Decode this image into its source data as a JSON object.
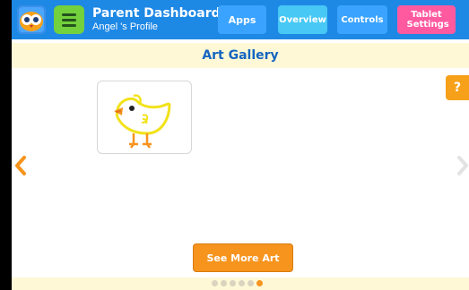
{
  "header": {
    "title": "Parent Dashboard",
    "subtitle": "Angel 's Profile",
    "tabs": [
      {
        "label": "Apps"
      },
      {
        "label": "Overview"
      },
      {
        "label": "Controls"
      },
      {
        "label": "Tablet Settings"
      }
    ],
    "active_tab": "Overview",
    "icons": {
      "logo": "owl-face-icon",
      "menu": "hamburger-menu-icon"
    }
  },
  "section": {
    "title": "Art Gallery"
  },
  "help": {
    "label": "?"
  },
  "gallery": {
    "items": [
      {
        "name": "chick-drawing",
        "description_icon": "chick-drawing"
      }
    ],
    "prev_icon": "chevron-left-icon",
    "next_icon": "chevron-right-icon"
  },
  "actions": {
    "see_more_label": "See More Art"
  },
  "pagination": {
    "total": 6,
    "active_index": 6
  },
  "colors": {
    "header": "#1e88e5",
    "tab": "#3aa3ff",
    "tab_active": "#47c8f5",
    "tab_settings": "#ff5aa0",
    "accent_orange": "#f7941d",
    "section_bg": "#fff8d6",
    "section_text": "#1565c0"
  }
}
